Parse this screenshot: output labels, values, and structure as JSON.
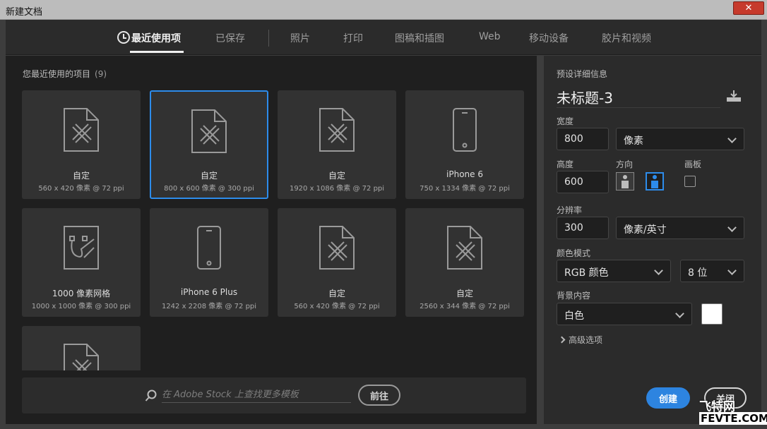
{
  "window": {
    "title": "新建文档",
    "close_glyph": "✕"
  },
  "tabs": [
    {
      "label": "最近使用项",
      "active": true,
      "icon": "clock-icon"
    },
    {
      "label": "已保存"
    },
    {
      "label": "照片"
    },
    {
      "label": "打印"
    },
    {
      "label": "图稿和插图"
    },
    {
      "label": "Web"
    },
    {
      "label": "移动设备"
    },
    {
      "label": "胶片和视频"
    }
  ],
  "recent": {
    "heading": "您最近使用的项目",
    "count": "(9)",
    "items": [
      {
        "name": "自定",
        "meta": "560 x 420 像素 @ 72 ppi",
        "icon": "document-custom-icon"
      },
      {
        "name": "自定",
        "meta": "800 x 600 像素 @ 300 ppi",
        "icon": "document-custom-icon",
        "selected": true
      },
      {
        "name": "自定",
        "meta": "1920 x 1086 像素 @ 72 ppi",
        "icon": "document-custom-icon"
      },
      {
        "name": "iPhone 6",
        "meta": "750 x 1334 像素 @ 72 ppi",
        "icon": "phone-icon"
      },
      {
        "name": "1000 像素网格",
        "meta": "1000 x 1000 像素 @ 300 ppi",
        "icon": "pixel-grid-icon"
      },
      {
        "name": "iPhone 6 Plus",
        "meta": "1242 x 2208 像素 @ 72 ppi",
        "icon": "phone-icon"
      },
      {
        "name": "自定",
        "meta": "560 x 420 像素 @ 72 ppi",
        "icon": "document-custom-icon"
      },
      {
        "name": "自定",
        "meta": "2560 x 344 像素 @ 72 ppi",
        "icon": "document-custom-icon"
      },
      {
        "name": "",
        "meta": "",
        "icon": "document-custom-icon"
      }
    ]
  },
  "search": {
    "placeholder": "在 Adobe Stock 上查找更多模板",
    "go_label": "前往"
  },
  "preset": {
    "heading": "预设详细信息",
    "doc_name": "未标题-3",
    "width_label": "宽度",
    "width_value": "800",
    "width_unit": "像素",
    "height_label": "高度",
    "height_value": "600",
    "orientation_label": "方向",
    "artboard_label": "画板",
    "resolution_label": "分辨率",
    "resolution_value": "300",
    "resolution_unit": "像素/英寸",
    "color_mode_label": "颜色模式",
    "color_mode": "RGB 颜色",
    "bit_depth": "8 位",
    "background_label": "背景内容",
    "background": "白色",
    "background_color": "#ffffff",
    "advanced_label": "高级选项",
    "create_label": "创建",
    "close_label": "关闭"
  },
  "watermark": {
    "line1": "飞特网",
    "line2": "FEVTE.COM"
  },
  "colors": {
    "accent": "#2d8ceb",
    "create": "#2d84e0"
  }
}
